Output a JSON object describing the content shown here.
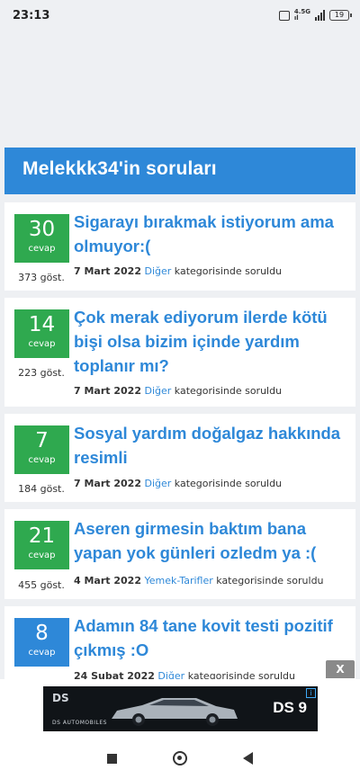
{
  "status_bar": {
    "time": "23:13",
    "network_top": "4.5G",
    "network_bottom": "ıl",
    "battery": "19"
  },
  "page": {
    "title": "Melekkk34'in soruları"
  },
  "questions": [
    {
      "answers": "30",
      "answers_label": "cevap",
      "views": "373 göst.",
      "title": "Sigarayı bırakmak istiyorum ama olmuyor:(",
      "date": "7 Mart 2022",
      "category": "Diğer",
      "suffix": "kategorisinde soruldu"
    },
    {
      "answers": "14",
      "answers_label": "cevap",
      "views": "223 göst.",
      "title": "Çok merak ediyorum ilerde kötü bişi olsa bizim içinde yardım toplanır mı?",
      "date": "7 Mart 2022",
      "category": "Diğer",
      "suffix": "kategorisinde soruldu"
    },
    {
      "answers": "7",
      "answers_label": "cevap",
      "views": "184 göst.",
      "title": "Sosyal yardım doğalgaz hakkında resimli",
      "date": "7 Mart 2022",
      "category": "Diğer",
      "suffix": "kategorisinde soruldu"
    },
    {
      "answers": "21",
      "answers_label": "cevap",
      "views": "455 göst.",
      "title": "Aseren girmesin baktım bana yapan yok günleri ozledm ya :(",
      "date": "4 Mart 2022",
      "category": "Yemek-Tarifler",
      "suffix": "kategorisinde soruldu"
    },
    {
      "answers": "8",
      "answers_label": "cevap",
      "views": "",
      "title": "Adamın 84 tane kovit testi pozitif çıkmış :O",
      "date": "24 Şubat 2022",
      "category": "Diğer",
      "suffix": "kategorisinde soruldu"
    }
  ],
  "ad": {
    "close_label": "X",
    "brand_mark": "DS",
    "brand_name": "DS AUTOMOBILES",
    "model": "DS 9",
    "info_mark": "i"
  },
  "colors": {
    "accent_blue": "#2e88d8",
    "badge_green": "#2fa94f",
    "background": "#eef0f3"
  }
}
